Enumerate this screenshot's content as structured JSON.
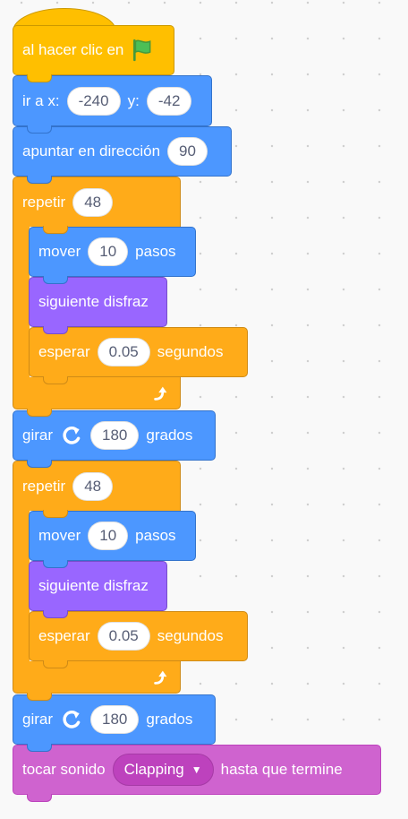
{
  "colors": {
    "motion": "#4c97ff",
    "control": "#ffab19",
    "event": "#ffbf00",
    "looks": "#9966ff",
    "sound": "#cf63cf"
  },
  "script": {
    "when_flag": {
      "label": "al hacer clic en",
      "icon": "green-flag-icon"
    },
    "goto": {
      "label": "ir a x:",
      "x": "-240",
      "y_label": "y:",
      "y": "-42"
    },
    "point": {
      "label": "apuntar en dirección",
      "value": "90"
    },
    "loops": [
      {
        "label": "repetir",
        "times": "48",
        "move": {
          "label": "mover",
          "steps": "10",
          "unit": "pasos"
        },
        "next_costume": {
          "label": "siguiente disfraz"
        },
        "wait": {
          "label": "esperar",
          "value": "0.05",
          "unit": "segundos"
        },
        "loop_icon": "loop-arrow-icon"
      },
      {
        "label": "repetir",
        "times": "48",
        "move": {
          "label": "mover",
          "steps": "10",
          "unit": "pasos"
        },
        "next_costume": {
          "label": "siguiente disfraz"
        },
        "wait": {
          "label": "esperar",
          "value": "0.05",
          "unit": "segundos"
        },
        "loop_icon": "loop-arrow-icon"
      }
    ],
    "turns": [
      {
        "label": "girar",
        "icon": "rotate-right-icon",
        "value": "180",
        "unit": "grados"
      },
      {
        "label": "girar",
        "icon": "rotate-right-icon",
        "value": "180",
        "unit": "grados"
      }
    ],
    "play_sound": {
      "label": "tocar sonido",
      "sound": "Clapping",
      "suffix": "hasta que termine"
    }
  }
}
